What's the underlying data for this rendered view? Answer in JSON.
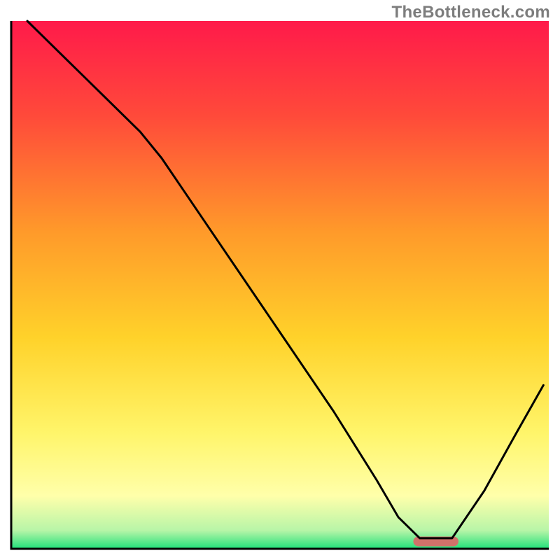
{
  "watermark": "TheBottleneck.com",
  "chart_data": {
    "type": "line",
    "title": "",
    "xlabel": "",
    "ylabel": "",
    "xlim": [
      0,
      100
    ],
    "ylim": [
      0,
      100
    ],
    "grid": false,
    "legend": false,
    "gradient_stops": [
      {
        "offset": 0.0,
        "color": "#ff1a4a"
      },
      {
        "offset": 0.18,
        "color": "#ff4a3a"
      },
      {
        "offset": 0.4,
        "color": "#ff9a2a"
      },
      {
        "offset": 0.6,
        "color": "#ffd22a"
      },
      {
        "offset": 0.78,
        "color": "#fff56a"
      },
      {
        "offset": 0.9,
        "color": "#ffffaa"
      },
      {
        "offset": 0.965,
        "color": "#b8f5a8"
      },
      {
        "offset": 1.0,
        "color": "#20e07a"
      }
    ],
    "series": [
      {
        "name": "bottleneck-curve",
        "x": [
          3,
          12,
          24,
          28,
          40,
          52,
          60,
          68,
          72,
          76,
          82,
          88,
          94,
          99
        ],
        "y": [
          100,
          91,
          79,
          74,
          56,
          38,
          26,
          13,
          6,
          2,
          2,
          11,
          22,
          31
        ]
      }
    ],
    "marker": {
      "name": "optimal-range-marker",
      "x_center": 79,
      "x_halfwidth": 4.2,
      "y": 1.4,
      "color": "#d0726a"
    },
    "axis_color": "#000000",
    "axis_width": 3
  }
}
